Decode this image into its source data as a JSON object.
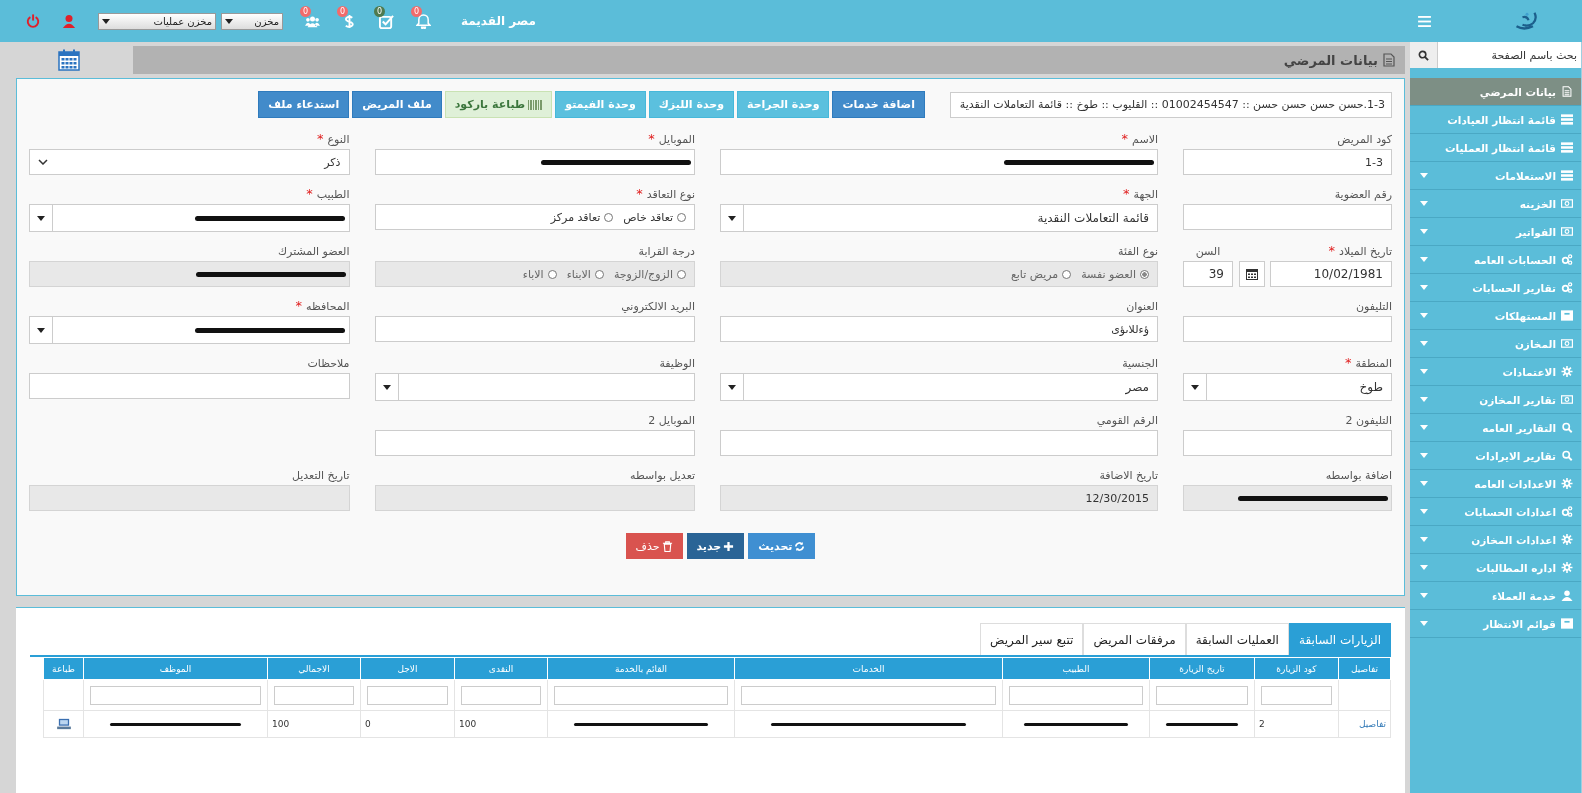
{
  "topbar": {
    "region": "مصر القديمة",
    "notifications": [
      {
        "kind": "bell",
        "count": "0",
        "color": "#f26b6b"
      },
      {
        "kind": "check",
        "count": "0",
        "color": "#4f7a4f"
      },
      {
        "kind": "dollar",
        "count": "0",
        "color": "#f26b6b"
      },
      {
        "kind": "users",
        "count": "0",
        "color": "#f26b6b"
      }
    ],
    "selects": [
      {
        "value": "مخزن"
      },
      {
        "value": "مخزن عمليات"
      }
    ]
  },
  "sidebar": {
    "search": {
      "placeholder": "بحث باسم الصفحة"
    },
    "items": [
      {
        "label": "بيانات المرضي",
        "kind": "file",
        "selected": true,
        "expandable": false
      },
      {
        "label": "قائمة انتظار العيادات",
        "kind": "list",
        "selected": false,
        "expandable": false
      },
      {
        "label": "قائمة انتظار العمليات",
        "kind": "list",
        "selected": false,
        "expandable": false
      },
      {
        "label": "الاستعلامات",
        "kind": "list",
        "selected": false,
        "expandable": true
      },
      {
        "label": "الخزينه",
        "kind": "money",
        "selected": false,
        "expandable": true
      },
      {
        "label": "الفواتير",
        "kind": "money",
        "selected": false,
        "expandable": true
      },
      {
        "label": "الحسابات العامه",
        "kind": "cogs",
        "selected": false,
        "expandable": true
      },
      {
        "label": "تقارير الحسابات",
        "kind": "cogs",
        "selected": false,
        "expandable": true
      },
      {
        "label": "المستهلكات",
        "kind": "box",
        "selected": false,
        "expandable": true
      },
      {
        "label": "المخازن",
        "kind": "money",
        "selected": false,
        "expandable": true
      },
      {
        "label": "الاعتمادات",
        "kind": "gear",
        "selected": false,
        "expandable": true
      },
      {
        "label": "تقارير المخازن",
        "kind": "money",
        "selected": false,
        "expandable": true
      },
      {
        "label": "التقارير العامه",
        "kind": "search",
        "selected": false,
        "expandable": true
      },
      {
        "label": "تقارير الايرادات",
        "kind": "search",
        "selected": false,
        "expandable": true
      },
      {
        "label": "الاعدادات العامه",
        "kind": "gear",
        "selected": false,
        "expandable": true
      },
      {
        "label": "اعدادات الحسابات",
        "kind": "cogs",
        "selected": false,
        "expandable": true
      },
      {
        "label": "اعدادات المخازن",
        "kind": "gear",
        "selected": false,
        "expandable": true
      },
      {
        "label": "اداره المطالبات",
        "kind": "gear",
        "selected": false,
        "expandable": true
      },
      {
        "label": "خدمة العملاء",
        "kind": "user",
        "selected": false,
        "expandable": true
      },
      {
        "label": "قوائم الانتظار",
        "kind": "box",
        "selected": false,
        "expandable": true
      }
    ]
  },
  "page_title": "بيانات المرضي",
  "patient_summary": "1-3.حسن حسن حسن حسن :: 01002454547 :: القليوب :: طوخ :: قائمة التعاملات النقدية",
  "actions": [
    {
      "label": "اضافة خدمات",
      "kind": "primary"
    },
    {
      "label": "وحدة الجراحة",
      "kind": "info"
    },
    {
      "label": "وحدة الليزك",
      "kind": "info"
    },
    {
      "label": "وحدة الفيمتو",
      "kind": "info"
    },
    {
      "label": "طباعة باركود",
      "kind": "barcode"
    },
    {
      "label": "ملف المريض",
      "kind": "primary"
    },
    {
      "label": "استدعاء ملف",
      "kind": "primary"
    }
  ],
  "field_rows": [
    [
      {
        "kind": "text",
        "label": "كود المريض",
        "disabled": false,
        "redacted": false,
        "value": "1-3"
      },
      {
        "kind": "text",
        "label": "الاسم",
        "required_mark": "*",
        "disabled": false,
        "redacted": true
      },
      {
        "kind": "text",
        "label": "الموبايل",
        "required_mark": "*",
        "disabled": false,
        "redacted": true
      },
      {
        "kind": "select",
        "label": "النوع",
        "required_mark": "*",
        "disabled": false,
        "redacted": false,
        "value": "ذكر"
      }
    ],
    [
      {
        "kind": "text",
        "label": "رقم العضوية",
        "disabled": false,
        "redacted": false
      },
      {
        "kind": "combo",
        "label": "الجهة",
        "required_mark": "*",
        "disabled": false,
        "redacted": false,
        "value": "قائمة التعاملات النقدية"
      },
      {
        "kind": "radio",
        "label": "نوع التعاقد",
        "required_mark": "*",
        "disabled": false,
        "redacted": false,
        "options": [
          {
            "label": "تعاقد خاص",
            "checked": false
          },
          {
            "label": "تعاقد مركز",
            "checked": false
          }
        ]
      },
      {
        "kind": "combo",
        "label": "الطبيب",
        "required_mark": "*",
        "disabled": false,
        "redacted": true
      }
    ],
    [
      {
        "kind": "date",
        "label": "تاريخ الميلاد",
        "required_mark": "*",
        "disabled": false,
        "redacted": false,
        "value": "10/02/1981",
        "age_label": "السن",
        "age": "39"
      },
      {
        "kind": "radio",
        "label": "نوع الفئة",
        "disabled": true,
        "redacted": false,
        "options": [
          {
            "label": "العضو نفسة",
            "checked": true
          },
          {
            "label": "مريض تابع",
            "checked": false
          }
        ]
      },
      {
        "kind": "radio",
        "label": "درجة القرابة",
        "disabled": true,
        "redacted": false,
        "options": [
          {
            "label": "الزوج/الزوجة",
            "checked": false
          },
          {
            "label": "الابناء",
            "checked": false
          },
          {
            "label": "الاباء",
            "checked": false
          }
        ]
      },
      {
        "kind": "text",
        "label": "العضو المشترك",
        "disabled": true,
        "redacted": true
      }
    ],
    [
      {
        "kind": "text",
        "label": "التليفون",
        "disabled": false,
        "redacted": false
      },
      {
        "kind": "text",
        "label": "العنوان",
        "disabled": false,
        "redacted": false,
        "value": "ؤءللاىؤى"
      },
      {
        "kind": "text",
        "label": "البريد الالكتروني",
        "disabled": false,
        "redacted": false
      },
      {
        "kind": "combo",
        "label": "المحافظه",
        "required_mark": "*",
        "disabled": false,
        "redacted": true
      }
    ],
    [
      {
        "kind": "combo",
        "label": "المنطقة",
        "required_mark": "*",
        "disabled": false,
        "redacted": false,
        "value": "طوخ"
      },
      {
        "kind": "combo",
        "label": "الجنسية",
        "disabled": false,
        "redacted": false,
        "value": "مصر"
      },
      {
        "kind": "combo",
        "label": "الوظيفة",
        "disabled": false,
        "redacted": false
      },
      {
        "kind": "text",
        "label": "ملاحظات",
        "disabled": false,
        "redacted": false
      }
    ],
    [
      {
        "kind": "text",
        "label": "التليفون 2",
        "disabled": false,
        "redacted": false
      },
      {
        "kind": "text",
        "label": "الرقم القومي",
        "disabled": false,
        "redacted": false
      },
      {
        "kind": "text",
        "label": "الموبايل 2",
        "disabled": false,
        "redacted": false
      }
    ],
    [
      {
        "kind": "text",
        "label": "اضافة بواسطه",
        "disabled": true,
        "redacted": true
      },
      {
        "kind": "text",
        "label": "تاريخ الاضافة",
        "disabled": true,
        "redacted": false,
        "value": "12/30/2015"
      },
      {
        "kind": "text",
        "label": "تعديل بواسطه",
        "disabled": true,
        "redacted": false
      },
      {
        "kind": "text",
        "label": "تاريخ التعديل",
        "disabled": true,
        "redacted": false
      }
    ]
  ],
  "form_buttons": [
    {
      "label": "تحديث",
      "kind": "refresh"
    },
    {
      "label": "جديد",
      "kind": "new"
    },
    {
      "label": "حذف",
      "kind": "delete"
    }
  ],
  "tabs": [
    {
      "label": "الزيارات السابقة",
      "selected": true
    },
    {
      "label": "العمليات السابقة",
      "selected": false
    },
    {
      "label": "مرفقات المريض",
      "selected": false
    },
    {
      "label": "تتبع سير المريض",
      "selected": false
    }
  ],
  "table": {
    "columns": [
      {
        "label": "تفاصيل",
        "filter": false
      },
      {
        "label": "كود الزيارة",
        "filter": true
      },
      {
        "label": "تاريخ الزيارة",
        "filter": true
      },
      {
        "label": "الطبيب",
        "filter": true
      },
      {
        "label": "الخدمات",
        "filter": true
      },
      {
        "label": "القائم بالخدمة",
        "filter": true
      },
      {
        "label": "النقدى",
        "filter": true
      },
      {
        "label": "الاجل",
        "filter": true
      },
      {
        "label": "الاجمالي",
        "filter": true
      },
      {
        "label": "الموظف",
        "filter": true
      },
      {
        "label": "طباعة",
        "filter": false
      }
    ],
    "rows": [
      [
        {
          "kind": "link",
          "text": "تفاصيل"
        },
        {
          "kind": "text",
          "text": "2"
        },
        {
          "kind": "redacted"
        },
        {
          "kind": "redacted"
        },
        {
          "kind": "redacted"
        },
        {
          "kind": "redacted"
        },
        {
          "kind": "text",
          "text": "100"
        },
        {
          "kind": "text",
          "text": "0"
        },
        {
          "kind": "text",
          "text": "100"
        },
        {
          "kind": "redacted"
        },
        {
          "kind": "print"
        }
      ]
    ]
  }
}
